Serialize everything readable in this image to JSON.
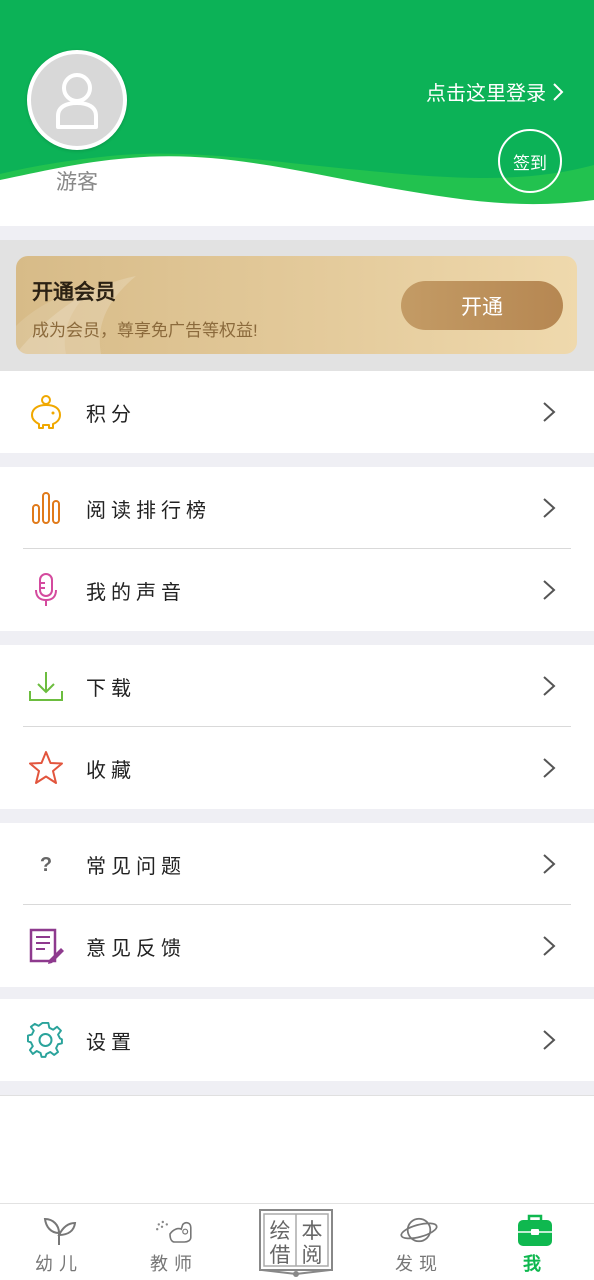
{
  "header": {
    "guest_name": "游客",
    "login_text": "点击这里登录",
    "checkin_label": "签到"
  },
  "vip": {
    "title": "开通会员",
    "subtitle": "成为会员，尊享免广告等权益!",
    "button_label": "开通"
  },
  "menu": {
    "points": {
      "label": "积分",
      "icon": "piggy-bank-icon"
    },
    "reading_rank": {
      "label": "阅读排行榜",
      "icon": "bar-chart-icon"
    },
    "my_voice": {
      "label": "我的声音",
      "icon": "microphone-icon"
    },
    "download": {
      "label": "下载",
      "icon": "download-icon"
    },
    "favorites": {
      "label": "收藏",
      "icon": "star-icon"
    },
    "faq": {
      "label": "常见问题",
      "icon": "question-icon"
    },
    "feedback": {
      "label": "意见反馈",
      "icon": "edit-note-icon"
    },
    "settings": {
      "label": "设置",
      "icon": "gear-icon"
    }
  },
  "tabbar": {
    "tabs": [
      {
        "label": "幼儿",
        "icon": "sprout-icon"
      },
      {
        "label": "教师",
        "icon": "teacher-icon"
      },
      {
        "label": "绘本借阅",
        "icon": "picture-book-icon",
        "chars": [
          "绘",
          "本",
          "借",
          "阅"
        ]
      },
      {
        "label": "发现",
        "icon": "planet-icon"
      },
      {
        "label": "我",
        "icon": "briefcase-icon",
        "active": true
      }
    ]
  },
  "colors": {
    "brand_green": "#0fb84f",
    "gold": "#b68752",
    "active_tab": "#0fb84f"
  }
}
